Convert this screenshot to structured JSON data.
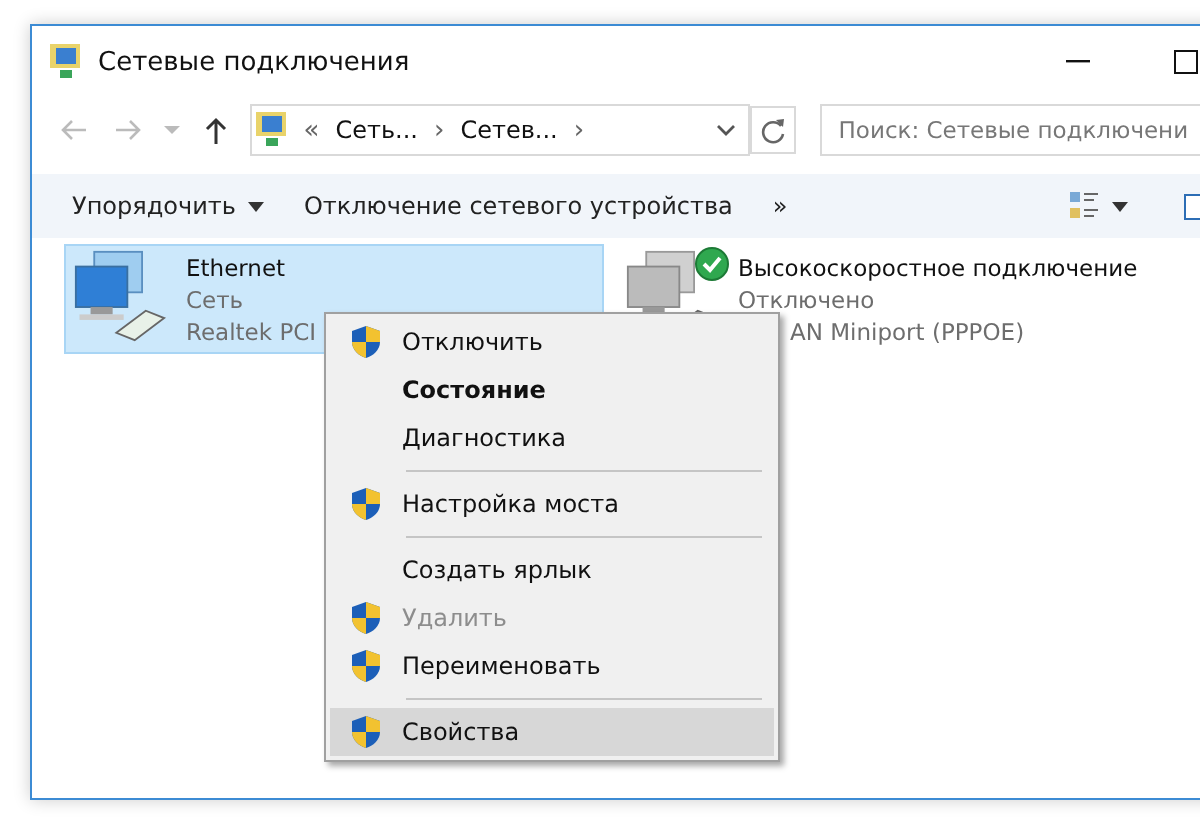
{
  "window": {
    "title": "Сетевые подключения"
  },
  "address_bar": {
    "prefix": "«",
    "segments": [
      "Сеть...",
      "Сетев..."
    ],
    "separator": "›"
  },
  "search": {
    "placeholder": "Поиск: Сетевые подключени"
  },
  "toolbar": {
    "items": [
      {
        "label": "Упорядочить",
        "dropdown": true
      },
      {
        "label": "Отключение сетевого устройства",
        "dropdown": false
      },
      {
        "label": "»",
        "dropdown": false
      }
    ]
  },
  "connections": [
    {
      "name": "Ethernet",
      "status": "Сеть",
      "adapter": "Realtek PCI",
      "selected": true,
      "connected": true
    },
    {
      "name": "Высокоскоростное подключение",
      "status": "Отключено",
      "adapter": "AN Miniport (PPPOE)",
      "selected": false,
      "connected": false
    }
  ],
  "context_menu": {
    "items": [
      {
        "kind": "item",
        "label": "Отключить",
        "shield": true,
        "bold": false,
        "disabled": false,
        "selected": false
      },
      {
        "kind": "item",
        "label": "Состояние",
        "shield": false,
        "bold": true,
        "disabled": false,
        "selected": false
      },
      {
        "kind": "item",
        "label": "Диагностика",
        "shield": false,
        "bold": false,
        "disabled": false,
        "selected": false
      },
      {
        "kind": "separator"
      },
      {
        "kind": "item",
        "label": "Настройка моста",
        "shield": true,
        "bold": false,
        "disabled": false,
        "selected": false
      },
      {
        "kind": "separator"
      },
      {
        "kind": "item",
        "label": "Создать ярлык",
        "shield": false,
        "bold": false,
        "disabled": false,
        "selected": false
      },
      {
        "kind": "item",
        "label": "Удалить",
        "shield": true,
        "bold": false,
        "disabled": true,
        "selected": false
      },
      {
        "kind": "item",
        "label": "Переименовать",
        "shield": true,
        "bold": false,
        "disabled": false,
        "selected": false
      },
      {
        "kind": "separator"
      },
      {
        "kind": "item",
        "label": "Свойства",
        "shield": true,
        "bold": false,
        "disabled": false,
        "selected": true
      }
    ]
  }
}
